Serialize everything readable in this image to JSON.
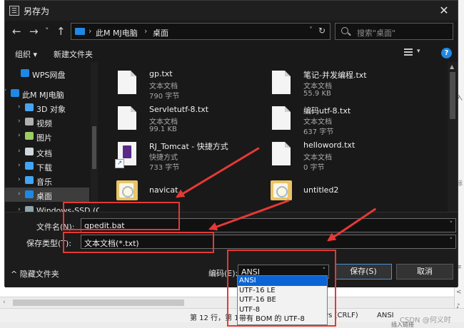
{
  "window": {
    "title": "另存为",
    "close": "✕"
  },
  "nav": {
    "back": "←",
    "forward": "→",
    "history": "˅",
    "up": "↑",
    "address_segments": [
      "此M  MJ电脑",
      "桌面"
    ],
    "address_sep": "›",
    "search_placeholder": "搜索\"桌面\""
  },
  "toolbar": {
    "organize": "组织 ▾",
    "new_folder": "新建文件夹",
    "help": "?"
  },
  "sidebar": {
    "items": [
      {
        "label": "WPS网盘",
        "icon": "wps-cloud-icon",
        "color": "#1e88e5",
        "level": 1,
        "chev": ""
      },
      {
        "label": "此M  MJ电脑",
        "icon": "computer-icon",
        "color": "#1e88e5",
        "level": 0,
        "chev": "˅"
      },
      {
        "label": "3D 对象",
        "icon": "3d-objects-icon",
        "color": "#4aa3f0",
        "level": 2,
        "chev": "›"
      },
      {
        "label": "视频",
        "icon": "video-icon",
        "color": "#b0b0b0",
        "level": 2,
        "chev": "›"
      },
      {
        "label": "图片",
        "icon": "pictures-icon",
        "color": "#9ccc65",
        "level": 2,
        "chev": "›"
      },
      {
        "label": "文档",
        "icon": "documents-icon",
        "color": "#cfd8dc",
        "level": 2,
        "chev": "›"
      },
      {
        "label": "下载",
        "icon": "download-icon",
        "color": "#42a5f5",
        "level": 2,
        "chev": "›"
      },
      {
        "label": "音乐",
        "icon": "music-icon",
        "color": "#42a5f5",
        "level": 2,
        "chev": "›"
      },
      {
        "label": "桌面",
        "icon": "desktop-icon",
        "color": "#1e88e5",
        "level": 2,
        "chev": "›",
        "selected": true
      },
      {
        "label": "Windows-SSD (C",
        "icon": "drive-icon",
        "color": "#90a4ae",
        "level": 2,
        "chev": "›"
      }
    ]
  },
  "files": [
    {
      "name": "gp.txt",
      "type": "文本文档",
      "size": "790 字节",
      "kind": "doc"
    },
    {
      "name": "笔记-并发编程.txt",
      "type": "文本文档",
      "size": "55.9 KB",
      "kind": "doc"
    },
    {
      "name": "Servletutf-8.txt",
      "type": "文本文档",
      "size": "99.1 KB",
      "kind": "doc"
    },
    {
      "name": "编码utf-8.txt",
      "type": "文本文档",
      "size": "637 字节",
      "kind": "doc"
    },
    {
      "name": "RJ_Tomcat - 快捷方式",
      "type": "快捷方式",
      "size": "733 字节",
      "kind": "shortcut"
    },
    {
      "name": "helloword.txt",
      "type": "文本文档",
      "size": "0 字节",
      "kind": "doc"
    },
    {
      "name": "navicat",
      "type": "",
      "size": "",
      "kind": "folder"
    },
    {
      "name": "untitled2",
      "type": "",
      "size": "",
      "kind": "folder"
    }
  ],
  "form": {
    "filename_label": "文件名(N):",
    "filename_value": "gpedit.bat",
    "savetype_label": "保存类型(T):",
    "savetype_value": "文本文档(*.txt)",
    "hide_folders": "^  隐藏文件夹",
    "encoding_label": "编码(E):",
    "encoding_value": "ANSI",
    "save_button": "保存(S)",
    "cancel_button": "取消",
    "dropdown_arrow": "˅"
  },
  "encoding_options": [
    "ANSI",
    "UTF-16 LE",
    "UTF-16 BE",
    "UTF-8",
    "带有 BOM 的 UTF-8"
  ],
  "background": {
    "status_position": "第 12 行，第 1",
    "status_eol": "ws (CRLF)",
    "status_enc": "ANSI",
    "watermark": "CSDN @何义时",
    "insert_link": "插入链接",
    "right_chars": [
      "入",
      "标",
      "≡",
      "<",
      "♪"
    ]
  },
  "colors": {
    "highlight": "#e53935",
    "accent": "#1e88e5",
    "selected_option": "#0a64d6"
  }
}
